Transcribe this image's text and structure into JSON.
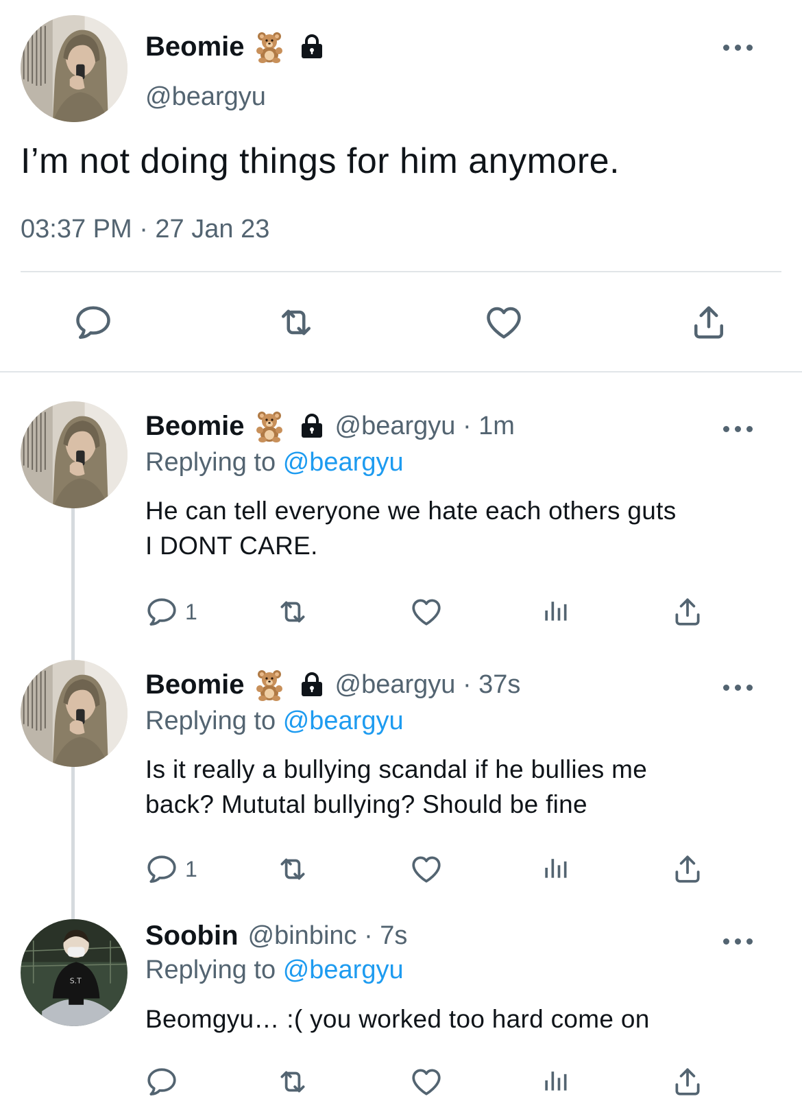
{
  "main_tweet": {
    "author_name": "Beomie",
    "handle": "@beargyu",
    "text": "I’m not doing things for him anymore.",
    "timestamp": "03:37 PM · 27 Jan 23",
    "badges": [
      "teddy-bear-emoji",
      "lock-icon"
    ],
    "actions": [
      "reply-icon",
      "retweet-icon",
      "like-icon",
      "share-icon"
    ]
  },
  "replies": [
    {
      "author_name": "Beomie",
      "handle_time": "@beargyu · 1m",
      "replying_prefix": "Replying to",
      "replying_to": "@beargyu",
      "text_line1": "He can tell everyone we hate each others guts",
      "text_line2": "I DONT CARE.",
      "reply_count": "1",
      "locked": true
    },
    {
      "author_name": "Beomie",
      "handle_time": "@beargyu · 37s",
      "replying_prefix": "Replying to",
      "replying_to": "@beargyu",
      "text_line1": "Is it really a bullying scandal if he bullies me",
      "text_line2": "back? Mututal bullying? Should be fine",
      "reply_count": "1",
      "locked": true
    },
    {
      "author_name": "Soobin",
      "handle_time": "@binbinc · 7s",
      "replying_prefix": "Replying to",
      "replying_to": "@beargyu",
      "text_line1": "Beomgyu… :( you worked too hard come on",
      "text_line2": "",
      "reply_count": "",
      "locked": false
    }
  ],
  "colors": {
    "text_primary": "#0f1419",
    "text_secondary": "#536471",
    "link_blue": "#1d9bf0",
    "divider": "#e1e5e8",
    "thread_line": "#d6dade"
  }
}
